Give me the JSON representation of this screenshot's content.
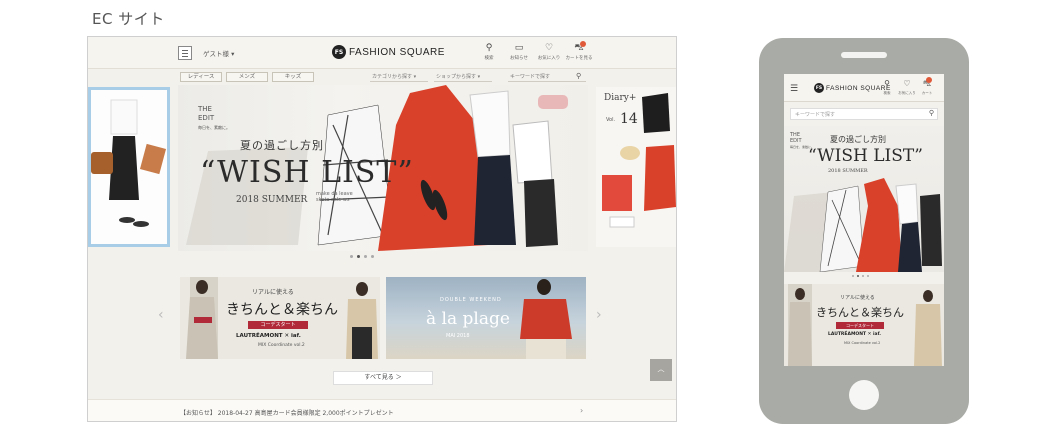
{
  "section_title": "EC サイト",
  "desktop": {
    "header": {
      "guest_label": "ゲスト様 ▾",
      "logo_mark": "FS",
      "logo_text": "FASHION SQUARE",
      "icons": [
        {
          "name": "search-icon",
          "glyph": "⚲",
          "label": "検索"
        },
        {
          "name": "message-icon",
          "glyph": "▭",
          "label": "お知らせ"
        },
        {
          "name": "heart-icon",
          "glyph": "♡",
          "label": "お気に入り"
        },
        {
          "name": "cart-icon",
          "glyph": "⛍",
          "label": "カートを見る"
        }
      ]
    },
    "subnav": {
      "tabs": [
        "レディース",
        "メンズ",
        "キッズ"
      ],
      "category_field": "カテゴリから探す ▾",
      "shop_field": "ショップから探す ▾",
      "keyword_placeholder": "キーワードで探す"
    },
    "banner": {
      "edit_mark": "THE\nEDIT\n毎日を、素敵に。",
      "subtitle": "夏の過ごし方別",
      "title": "“WISH LIST”",
      "season": "2018 SUMMER",
      "tagline": "make da leave skate sale ws",
      "right_title": "Diary+",
      "right_vol": "Vol.",
      "right_num": "14"
    },
    "cards": {
      "card1": {
        "head": "リアルに使える",
        "title": "きちんと＆楽ちん",
        "band": "コーデスタート",
        "collab": "LAUTRÉAMONT ✕ iaf.",
        "vol": "MIX Coordinate vol.2"
      },
      "card2": {
        "head": "DOUBLE WEEKEND",
        "title": "à la plage",
        "sub": "MAI 2018"
      }
    },
    "see_all": "すべて見る ＞",
    "page_top": "PAGE TOP",
    "notice": "【お知らせ】 2018-04-27 高島屋カード会員様限定 2,000ポイントプレゼント"
  },
  "phone": {
    "logo_mark": "FS",
    "logo_text": "FASHION SQUARE",
    "icons": [
      {
        "name": "search-icon",
        "glyph": "⚲",
        "label": "検索"
      },
      {
        "name": "heart-icon",
        "glyph": "♡",
        "label": "お気に入り"
      },
      {
        "name": "cart-icon",
        "glyph": "⛍",
        "label": "カート"
      }
    ],
    "search_placeholder": "キーワードで探す",
    "banner": {
      "edit_mark": "THE\nEDIT\n毎日を、素敵に。",
      "subtitle": "夏の過ごし方別",
      "title": "“WISH LIST”",
      "season": "2018 SUMMER"
    },
    "card": {
      "head": "リアルに使える",
      "title": "きちんと＆楽ちん",
      "band": "コーデスタート",
      "collab": "LAUTRÉAMONT ✕ iaf.",
      "vol": "MIX Coordinate vol.2"
    }
  },
  "colors": {
    "accent_red": "#d9412b",
    "card_band": "#b02a3a",
    "phone_body": "#a9aba6",
    "highlight_border": "#a8cde6"
  }
}
